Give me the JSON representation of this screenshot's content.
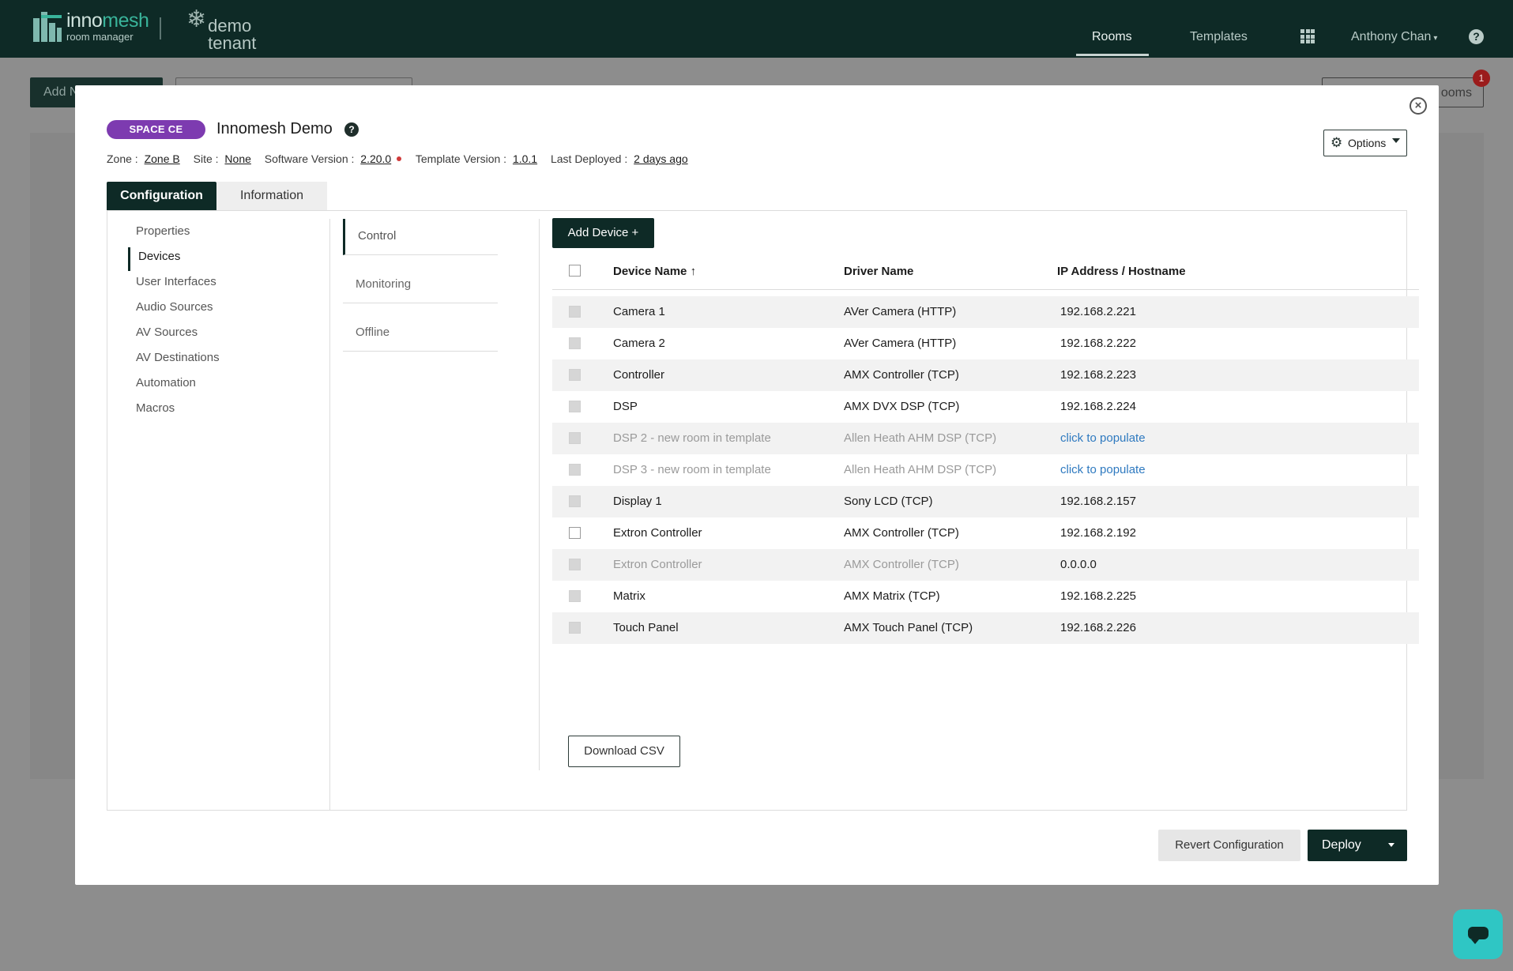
{
  "app": {
    "logo_word_a": "inno",
    "logo_word_b": "mesh",
    "logo_sub": "room manager",
    "tenant_line1": "demo",
    "tenant_line2": "tenant",
    "nav": {
      "rooms": "Rooms",
      "templates": "Templates",
      "user": "Anthony Chan"
    },
    "colors": {
      "brand_dark": "#0e2a26",
      "accent_purple": "#7d3bb0",
      "link_blue": "#2f7ac0",
      "alert_red": "#d03a3a",
      "chat_teal": "#2fc6c4"
    }
  },
  "background_page": {
    "add_button": "Add N",
    "rooms_button": "ooms",
    "badge_count": "1"
  },
  "modal": {
    "room_type": "SPACE CE",
    "room_name": "Innomesh Demo",
    "meta": {
      "zone_label": "Zone :",
      "zone_value": "Zone B",
      "site_label": "Site :",
      "site_value": "None",
      "software_label": "Software Version :",
      "software_value": "2.20.0",
      "template_label": "Template Version :",
      "template_value": "1.0.1",
      "deployed_label": "Last Deployed :",
      "deployed_value": "2 days ago"
    },
    "options_label": "Options",
    "tabs": [
      {
        "label": "Configuration",
        "active": true
      },
      {
        "label": "Information",
        "active": false
      }
    ],
    "sidebar": [
      {
        "label": "Properties"
      },
      {
        "label": "Devices",
        "active": true
      },
      {
        "label": "User Interfaces"
      },
      {
        "label": "Audio Sources"
      },
      {
        "label": "AV Sources"
      },
      {
        "label": "AV Destinations"
      },
      {
        "label": "Automation"
      },
      {
        "label": "Macros"
      }
    ],
    "categories": [
      {
        "label": "Control",
        "active": true
      },
      {
        "label": "Monitoring"
      },
      {
        "label": "Offline"
      }
    ],
    "add_device_label": "Add Device +",
    "table": {
      "headers": {
        "device": "Device Name",
        "sort_icon": "↑",
        "driver": "Driver Name",
        "ip": "IP Address / Hostname"
      },
      "rows": [
        {
          "device": "Camera 1",
          "driver": "AVer Camera (HTTP)",
          "ip": "192.168.2.221"
        },
        {
          "device": "Camera 2",
          "driver": "AVer Camera (HTTP)",
          "ip": "192.168.2.222"
        },
        {
          "device": "Controller",
          "driver": "AMX Controller (TCP)",
          "ip": "192.168.2.223"
        },
        {
          "device": "DSP",
          "driver": "AMX DVX DSP (TCP)",
          "ip": "192.168.2.224"
        },
        {
          "device": "DSP 2 - new room in template",
          "driver": "Allen Heath AHM DSP (TCP)",
          "ip": "click to populate"
        },
        {
          "device": "DSP 3 - new room in template",
          "driver": "Allen Heath AHM DSP (TCP)",
          "ip": "click to populate"
        },
        {
          "device": "Display 1",
          "driver": "Sony LCD (TCP)",
          "ip": "192.168.2.157"
        },
        {
          "device": "Extron Controller",
          "driver": "AMX Controller (TCP)",
          "ip": "192.168.2.192"
        },
        {
          "device": "Extron Controller",
          "driver": "AMX Controller (TCP)",
          "ip": "0.0.0.0"
        },
        {
          "device": "Matrix",
          "driver": "AMX Matrix (TCP)",
          "ip": "192.168.2.225"
        },
        {
          "device": "Touch Panel",
          "driver": "AMX Touch Panel (TCP)",
          "ip": "192.168.2.226"
        }
      ]
    },
    "download_csv_label": "Download CSV",
    "revert_label": "Revert Configuration",
    "deploy_label": "Deploy"
  }
}
